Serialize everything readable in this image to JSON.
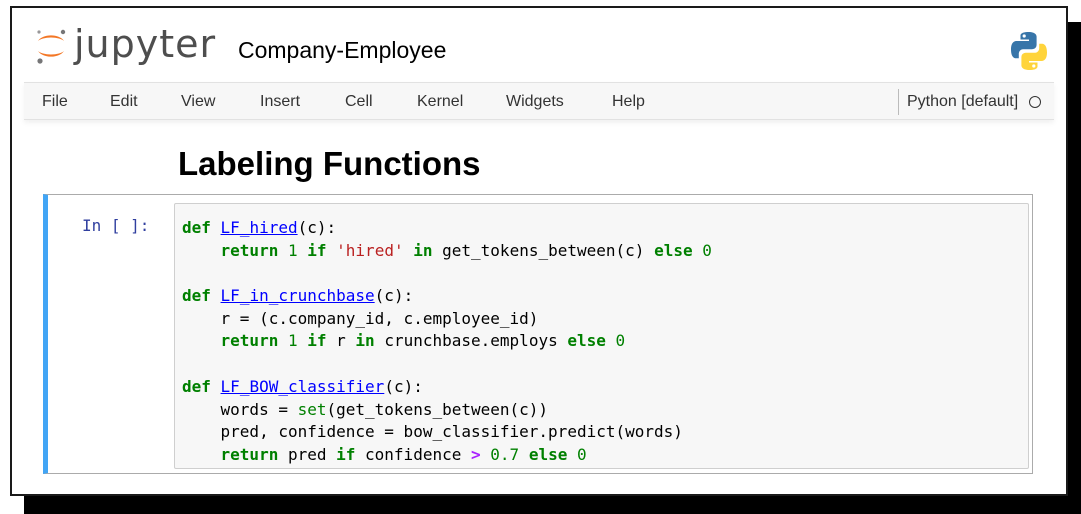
{
  "app": {
    "logo_text": "jupyter",
    "notebook_title": "Company-Employee"
  },
  "menu": [
    "File",
    "Edit",
    "View",
    "Insert",
    "Cell",
    "Kernel",
    "Widgets",
    "Help"
  ],
  "kernel": {
    "name": "Python [default]",
    "status": "idle"
  },
  "markdown": {
    "heading": "Labeling Functions"
  },
  "cell": {
    "prompt": "In [ ]:",
    "code_lines": [
      [
        {
          "t": "def",
          "c": "kw"
        },
        {
          "t": " "
        },
        {
          "t": "LF_hired",
          "c": "fn"
        },
        {
          "t": "(c):"
        }
      ],
      [
        {
          "t": "    "
        },
        {
          "t": "return",
          "c": "kw"
        },
        {
          "t": " "
        },
        {
          "t": "1",
          "c": "num"
        },
        {
          "t": " "
        },
        {
          "t": "if",
          "c": "kw"
        },
        {
          "t": " "
        },
        {
          "t": "'hired'",
          "c": "str"
        },
        {
          "t": " "
        },
        {
          "t": "in",
          "c": "kw"
        },
        {
          "t": " get_tokens_between(c) "
        },
        {
          "t": "else",
          "c": "kw"
        },
        {
          "t": " "
        },
        {
          "t": "0",
          "c": "num"
        }
      ],
      [],
      [
        {
          "t": "def",
          "c": "kw"
        },
        {
          "t": " "
        },
        {
          "t": "LF_in_crunchbase",
          "c": "fn"
        },
        {
          "t": "(c):"
        }
      ],
      [
        {
          "t": "    r = (c.company_id, c.employee_id)"
        }
      ],
      [
        {
          "t": "    "
        },
        {
          "t": "return",
          "c": "kw"
        },
        {
          "t": " "
        },
        {
          "t": "1",
          "c": "num"
        },
        {
          "t": " "
        },
        {
          "t": "if",
          "c": "kw"
        },
        {
          "t": " r "
        },
        {
          "t": "in",
          "c": "kw"
        },
        {
          "t": " crunchbase.employs "
        },
        {
          "t": "else",
          "c": "kw"
        },
        {
          "t": " "
        },
        {
          "t": "0",
          "c": "num"
        }
      ],
      [],
      [
        {
          "t": "def",
          "c": "kw"
        },
        {
          "t": " "
        },
        {
          "t": "LF_BOW_classifier",
          "c": "fn"
        },
        {
          "t": "(c):"
        }
      ],
      [
        {
          "t": "    words = "
        },
        {
          "t": "set",
          "c": "bi"
        },
        {
          "t": "(get_tokens_between(c))"
        }
      ],
      [
        {
          "t": "    pred, confidence = bow_classifier.predict(words)"
        }
      ],
      [
        {
          "t": "    "
        },
        {
          "t": "return",
          "c": "kw"
        },
        {
          "t": " pred "
        },
        {
          "t": "if",
          "c": "kw"
        },
        {
          "t": " confidence "
        },
        {
          "t": ">",
          "c": "op"
        },
        {
          "t": " "
        },
        {
          "t": "0.7",
          "c": "num"
        },
        {
          "t": " "
        },
        {
          "t": "else",
          "c": "kw"
        },
        {
          "t": " "
        },
        {
          "t": "0",
          "c": "num"
        }
      ]
    ]
  },
  "colors": {
    "cell_selected_bar": "#42a5f5",
    "prompt": "#303f9f",
    "keyword": "#008000",
    "function_name": "#0000ff",
    "string": "#ba2121",
    "operator": "#aa22ff",
    "jupyter_orange": "#f37726"
  },
  "icons": {
    "logo": "jupyter-logo-icon",
    "kernel_logo": "python-logo-icon",
    "kernel_status": "kernel-idle-circle-icon"
  }
}
